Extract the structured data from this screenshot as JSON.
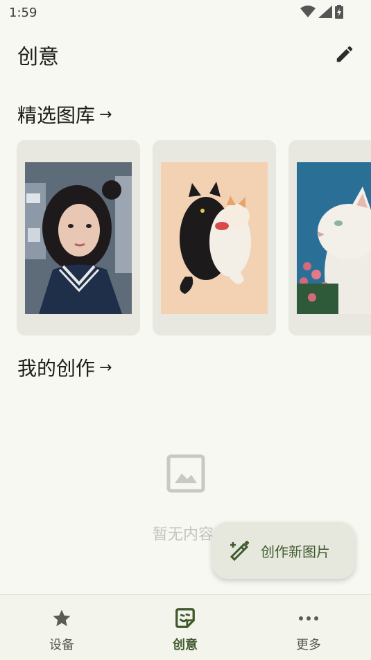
{
  "status_bar": {
    "time": "1:59"
  },
  "header": {
    "title": "创意",
    "edit_icon": "pencil-icon"
  },
  "gallery_section": {
    "title": "精选图库",
    "arrow": "→",
    "cards": [
      {
        "subject": "girl-portrait"
      },
      {
        "subject": "black-white-cats"
      },
      {
        "subject": "white-cat"
      }
    ]
  },
  "my_creations_section": {
    "title": "我的创作",
    "arrow": "→"
  },
  "empty_state": {
    "icon": "image-placeholder-icon",
    "text": "暂无内容"
  },
  "fab": {
    "label": "创作新图片",
    "icon": "magic-pen-icon"
  },
  "bottom_nav": {
    "items": [
      {
        "label": "设备",
        "icon": "star-icon",
        "active": false
      },
      {
        "label": "创意",
        "icon": "sticker-icon",
        "active": true
      },
      {
        "label": "更多",
        "icon": "more-dots-icon",
        "active": false
      }
    ]
  },
  "colors": {
    "background": "#f7f8f1",
    "accent": "#3f5a2c",
    "card": "#e8e8e1",
    "fab": "#e6e8dd"
  }
}
